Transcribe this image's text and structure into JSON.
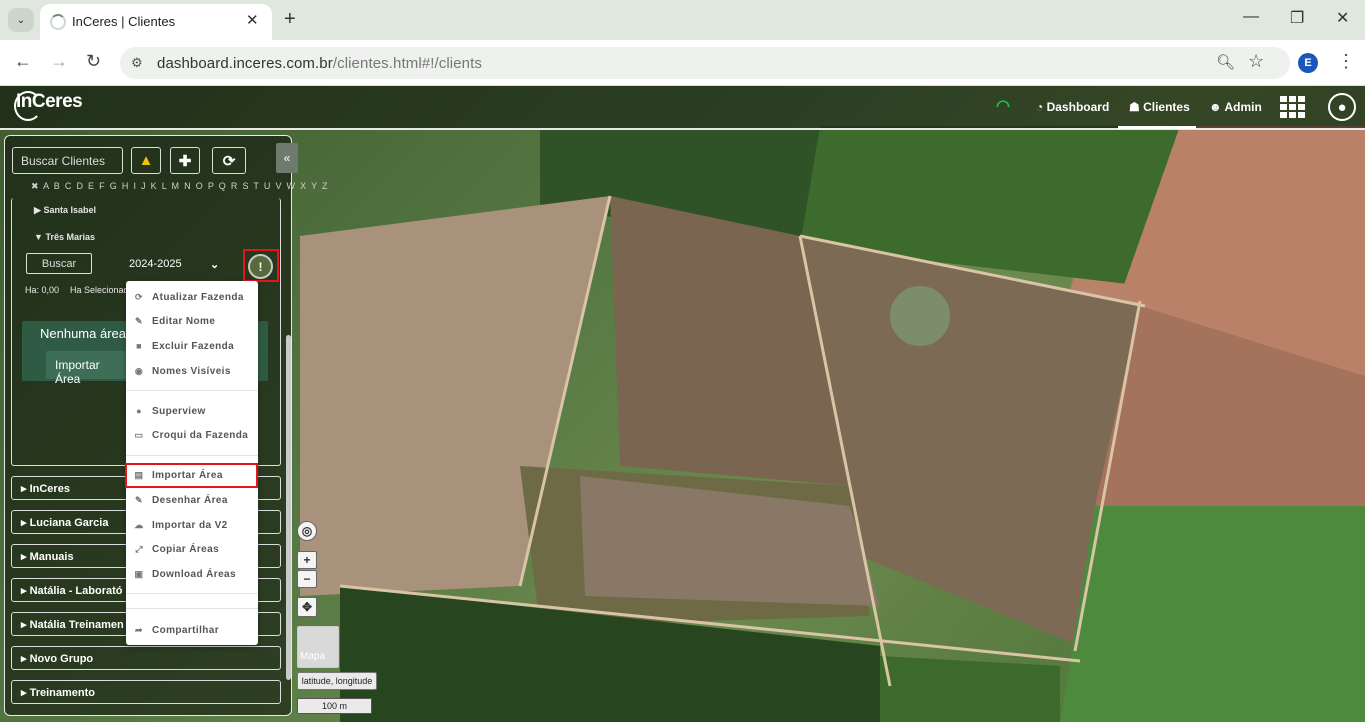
{
  "browser": {
    "tab_title": "InCeres | Clientes",
    "tab_close": "✕",
    "new_tab": "+",
    "url_host": "dashboard.inceres.com.br",
    "url_path": "/clientes.html#!/clients",
    "profile_initial": "E",
    "win_minimize": "—",
    "win_restore": "❐",
    "win_close": "✕"
  },
  "app": {
    "logo": "InCeres",
    "nav": {
      "dashboard": "Dashboard",
      "clientes": "Clientes",
      "admin": "Admin"
    }
  },
  "sidebar": {
    "search_placeholder": "Buscar Clientes",
    "alphabet": "✖ A B C D E F G H I J K L M N O P Q R S T U V W X Y Z",
    "farms": [
      {
        "label": "Santa Isabel",
        "arrow": "▶"
      },
      {
        "label": "Três Marias",
        "arrow": "▼"
      }
    ],
    "area_search_placeholder": "Buscar",
    "season": "2024-2025",
    "ha": "Ha: 0,00",
    "ha_selected": "Ha Selecionad",
    "empty_message": "Nenhuma área c",
    "import_button": "Importar Área",
    "clients": [
      "InCeres",
      "Luciana Garcia",
      "Manuais",
      "Natália - Laborató",
      "Natália Treinamen",
      "Novo Grupo",
      "Treinamento"
    ]
  },
  "menu": {
    "items": [
      {
        "label": "Atualizar Fazenda",
        "icon": "refresh-icon"
      },
      {
        "label": "Editar Nome",
        "icon": "pencil-icon"
      },
      {
        "label": "Excluir Fazenda",
        "icon": "trash-icon"
      },
      {
        "label": "Nomes Visíveis",
        "icon": "eye-icon"
      },
      {
        "label": "Superview",
        "icon": "globe-icon"
      },
      {
        "label": "Croqui da Fazenda",
        "icon": "map-icon"
      },
      {
        "label": "Importar Área",
        "icon": "file-import-icon"
      },
      {
        "label": "Desenhar Área",
        "icon": "pencil-icon"
      },
      {
        "label": "Importar da V2",
        "icon": "cloud-icon"
      },
      {
        "label": "Copiar Áreas",
        "icon": "copy-icon"
      },
      {
        "label": "Download Áreas",
        "icon": "download-icon"
      },
      {
        "label": "Compartilhar",
        "icon": "share-icon"
      }
    ]
  },
  "map": {
    "layer_label": "Mapa",
    "coords_label": "latitude, longitude",
    "scale_label": "100 m",
    "zoom_in": "+",
    "zoom_out": "−"
  },
  "colors": {
    "highlight": "#e0161b",
    "wifi": "#19c93a"
  }
}
